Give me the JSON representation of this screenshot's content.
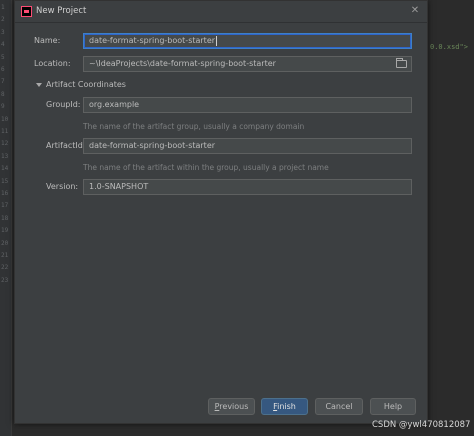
{
  "gutter": {
    "line_numbers": [
      "1",
      "2",
      "3",
      "4",
      "5",
      "6",
      "7",
      "8",
      "9",
      "10",
      "11",
      "12",
      "13",
      "14",
      "15",
      "16",
      "17",
      "18",
      "19",
      "20",
      "21",
      "22",
      "23"
    ]
  },
  "editor": {
    "code_snippet": "0.0.xsd\">"
  },
  "dialog": {
    "title": "New Project",
    "name_label": "Name:",
    "name_value": "date-format-spring-boot-starter",
    "location_label": "Location:",
    "location_value": "~\\IdeaProjects\\date-format-spring-boot-starter",
    "artifact_section_label": "Artifact Coordinates",
    "groupid_label": "GroupId:",
    "groupid_value": "org.example",
    "groupid_hint": "The name of the artifact group, usually a company domain",
    "artifactid_label": "ArtifactId:",
    "artifactid_value": "date-format-spring-boot-starter",
    "artifactid_hint": "The name of the artifact within the group, usually a project name",
    "version_label": "Version:",
    "version_value": "1.0-SNAPSHOT",
    "buttons": {
      "previous_mnemonic": "P",
      "previous_rest": "revious",
      "finish_mnemonic": "F",
      "finish_rest": "inish",
      "cancel": "Cancel",
      "help": "Help"
    }
  },
  "watermark": "CSDN @ywl470812087",
  "colors": {
    "dialog_bg": "#3c3f41",
    "field_bg": "#45494a",
    "focus_border": "#3d80c7",
    "primary_button": "#365880",
    "editor_bg": "#2b2b2b"
  },
  "icons": {
    "app": "intellij-idea-icon",
    "close": "close-icon",
    "browse": "folder-icon",
    "expand": "triangle-down-icon"
  }
}
